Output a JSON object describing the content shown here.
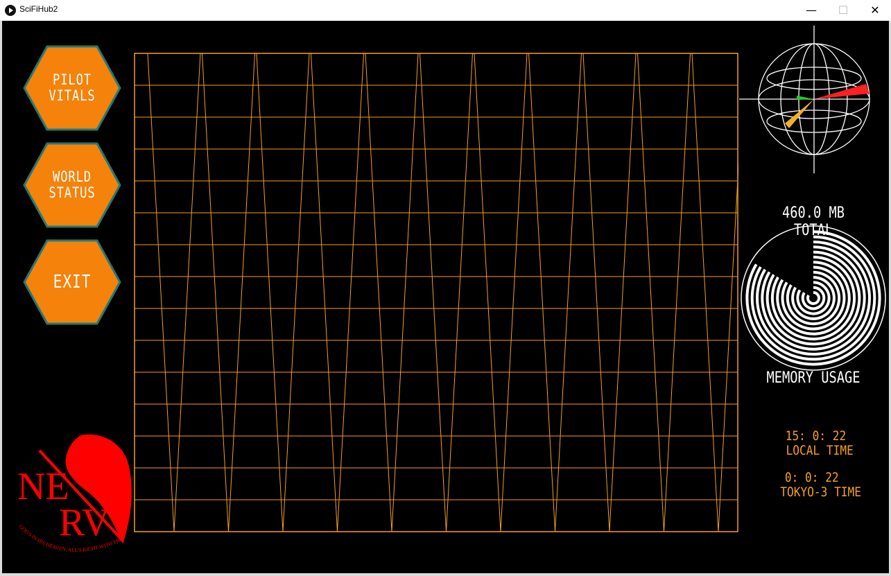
{
  "window": {
    "title": "SciFiHub2",
    "minimize_glyph": "—",
    "maximize_glyph": "☐",
    "close_glyph": "✕"
  },
  "menu": {
    "pilot_vitals": "PILOT VITALS",
    "world_status": "WORLD STATUS",
    "exit": "EXIT",
    "button_color": "#f5820a",
    "border_color": "#1f7a7a"
  },
  "memory": {
    "total_label": "460.0 MB TOTAL",
    "usage_label": "MEMORY USAGE"
  },
  "clocks": {
    "local_value": "15:  0:  22",
    "local_label": "LOCAL TIME",
    "tokyo_value": "0:  0:  22",
    "tokyo_label": "TOKYO-3 TIME"
  },
  "logo": {
    "text": "NERV",
    "motto": "GOD'S IN HIS HEAVEN. ALL'S RIGHT WITH THE WORLD",
    "color": "#ff0000"
  },
  "grid": {
    "line_color": "#f5a01a"
  },
  "globe": {
    "red_arm": "#ff2020",
    "green_arm": "#22cc22",
    "yellow_arm": "#f5b020"
  }
}
